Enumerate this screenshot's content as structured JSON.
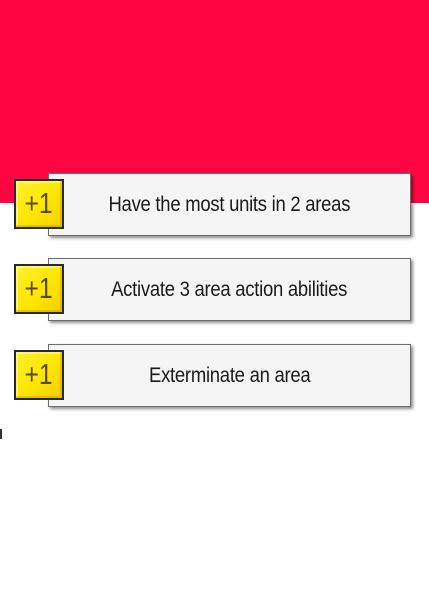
{
  "colors": {
    "top_band": "#ff0642",
    "badge_fill": "#ffe600",
    "card_fill": "#f5f5f5"
  },
  "objectives": [
    {
      "points": "+1",
      "text": "Have the most units in 2 areas"
    },
    {
      "points": "+1",
      "text": "Activate 3 area action abilities"
    },
    {
      "points": "+1",
      "text": "Exterminate an area"
    }
  ]
}
